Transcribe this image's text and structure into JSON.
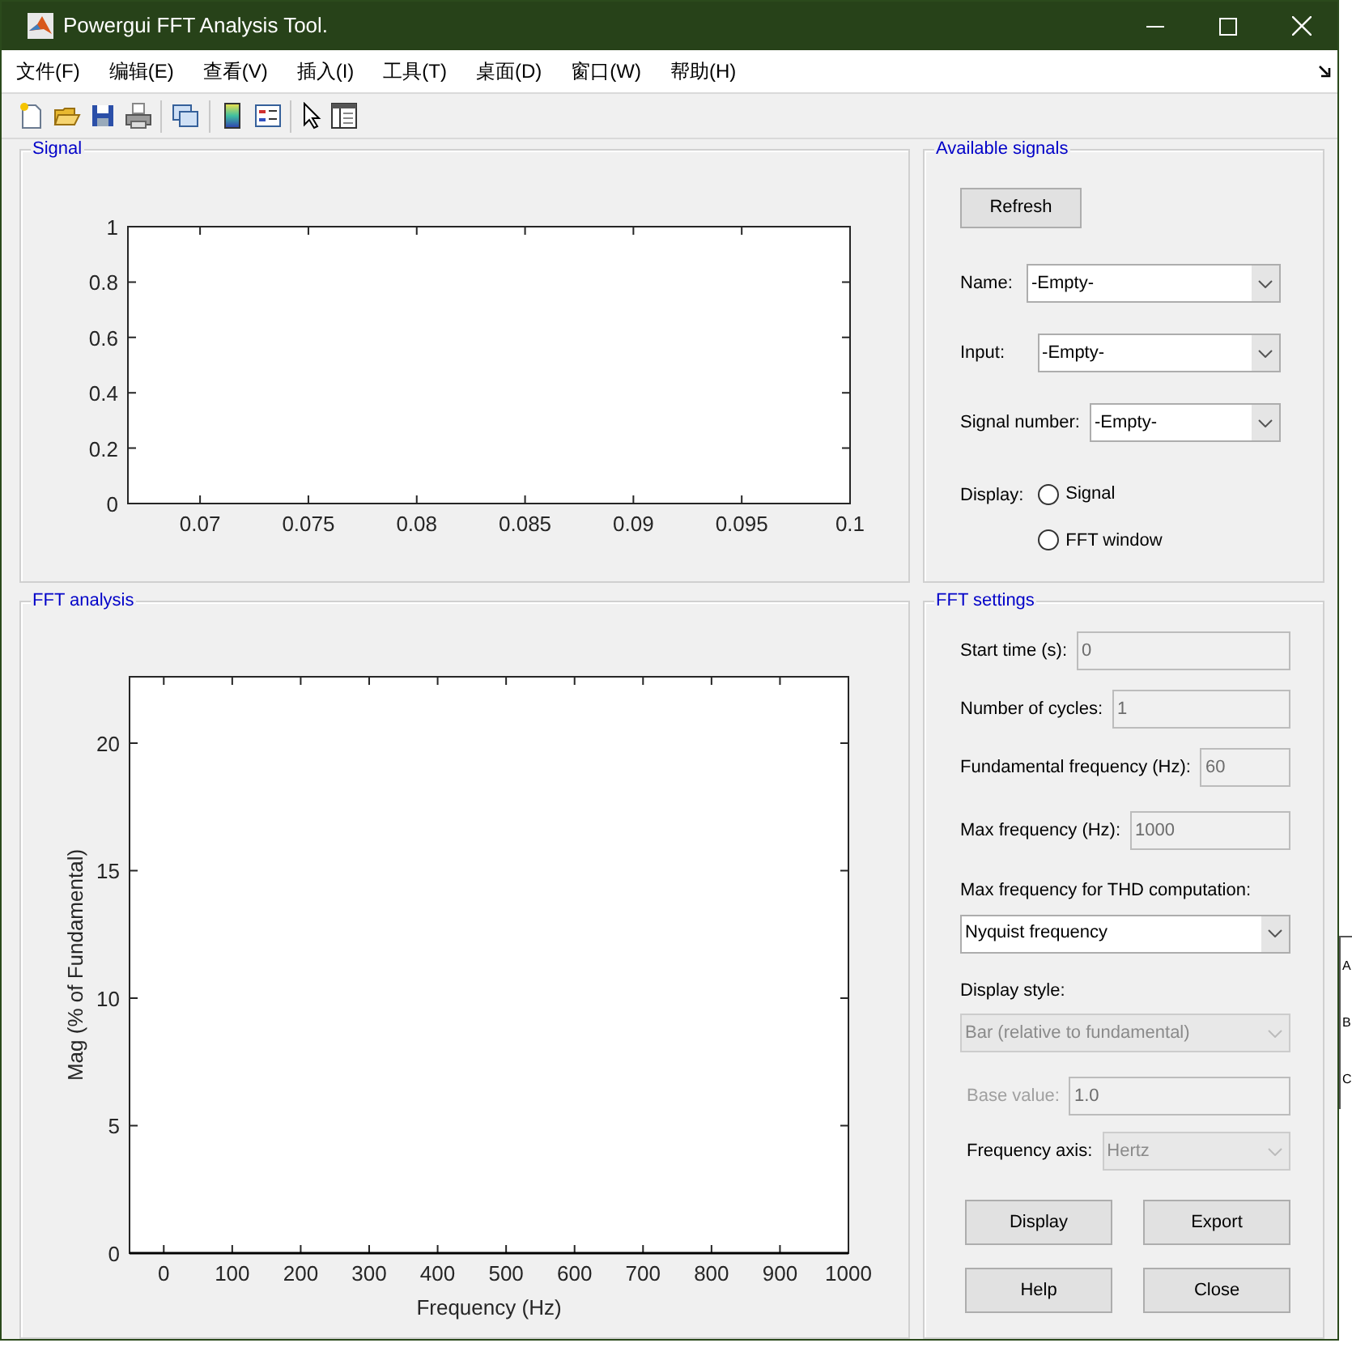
{
  "window": {
    "title": "Powergui FFT Analysis Tool."
  },
  "menu": [
    "文件(F)",
    "编辑(E)",
    "查看(V)",
    "插入(I)",
    "工具(T)",
    "桌面(D)",
    "窗口(W)",
    "帮助(H)"
  ],
  "signal_panel": {
    "title": "Signal",
    "chart_data": {
      "type": "line",
      "xlim": [
        0.06667,
        0.1
      ],
      "ylim": [
        0,
        1
      ],
      "xticks": [
        0.07,
        0.075,
        0.08,
        0.085,
        0.09,
        0.095,
        0.1
      ],
      "yticks": [
        0,
        0.2,
        0.4,
        0.6,
        0.8,
        1
      ]
    }
  },
  "available_signals": {
    "title": "Available signals",
    "refresh_button": "Refresh",
    "dropdowns": [
      {
        "label": "Name:",
        "value": "-Empty-"
      },
      {
        "label": "Input:",
        "value": "-Empty-"
      },
      {
        "label": "Signal number:",
        "value": "-Empty-"
      }
    ],
    "display": {
      "label": "Display:",
      "options": [
        {
          "label": "Signal",
          "selected": false
        },
        {
          "label": "FFT window",
          "selected": false
        }
      ]
    }
  },
  "fft_panel": {
    "title": "FFT analysis",
    "chart_data": {
      "type": "bar",
      "xlabel": "Frequency (Hz)",
      "ylabel": "Mag (% of Fundamental)",
      "xlim": [
        -50,
        1000
      ],
      "ylim": [
        0,
        22.6
      ],
      "xticks": [
        0,
        100,
        200,
        300,
        400,
        500,
        600,
        700,
        800,
        900,
        1000
      ],
      "yticks": [
        0,
        5,
        10,
        15,
        20
      ]
    }
  },
  "fft_settings": {
    "title": "FFT settings",
    "fields": [
      {
        "kind": "input",
        "label": "Start time (s):",
        "value": "0",
        "disabled": true
      },
      {
        "kind": "input",
        "label": "Number of cycles:",
        "value": "1",
        "disabled": true
      },
      {
        "kind": "input",
        "label": "Fundamental frequency (Hz):",
        "value": "60",
        "disabled": true
      },
      {
        "kind": "input",
        "label": "Max frequency (Hz):",
        "value": "1000",
        "disabled": true
      },
      {
        "kind": "stacked-select",
        "label": "Max frequency for THD computation:",
        "value": "Nyquist frequency",
        "disabled": false
      },
      {
        "kind": "stacked-select",
        "label": "Display style:",
        "value": "Bar (relative to fundamental)",
        "disabled": true
      },
      {
        "kind": "input",
        "label": "Base value:",
        "value": "1.0",
        "disabled": true,
        "label_disabled": true
      },
      {
        "kind": "select",
        "label": "Frequency axis:",
        "value": "Hertz",
        "disabled": true
      }
    ],
    "buttons": [
      "Display",
      "Export",
      "Help",
      "Close"
    ]
  },
  "background_window": {
    "letters": [
      "A",
      "B",
      "C"
    ]
  }
}
